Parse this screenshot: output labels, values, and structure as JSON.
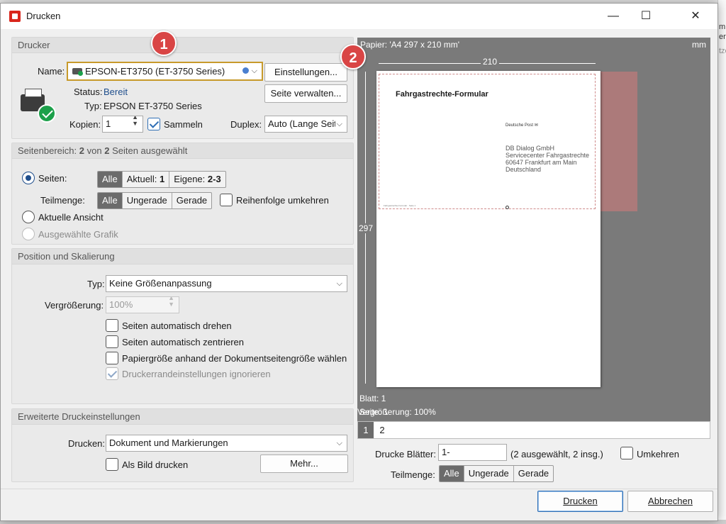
{
  "window": {
    "title": "Drucken",
    "minimize": "—",
    "maximize": "☐",
    "close": "✕"
  },
  "background": {
    "right_texts": [
      "m",
      "er",
      "tze"
    ]
  },
  "printer": {
    "section_title": "Drucker",
    "name_label": "Name:",
    "printer_name": "EPSON-ET3750 (ET-3750 Series)",
    "settings_button": "Einstellungen...",
    "manage_button": "Seite verwalten...",
    "status_label": "Status:",
    "status_value": "Bereit",
    "type_label": "Typ:",
    "type_value": "EPSON ET-3750 Series",
    "copies_label": "Kopien:",
    "copies_value": "1",
    "collate_label": "Sammeln",
    "duplex_label": "Duplex:",
    "duplex_value": "Auto (Lange Seit"
  },
  "range": {
    "section_prefix": "Seitenbereich:",
    "section_n1": "2",
    "section_mid": "von",
    "section_n2": "2",
    "section_suffix": "Seiten ausgewählt",
    "pages_label": "Seiten:",
    "pages_options": {
      "all": "Alle",
      "current_label": "Aktuell:",
      "current_value": "1",
      "custom_label": "Eigene:",
      "custom_value": "2-3"
    },
    "subset_label": "Teilmenge:",
    "subset_options": [
      "Alle",
      "Ungerade",
      "Gerade"
    ],
    "reverse_label": "Reihenfolge umkehren",
    "current_view_label": "Aktuelle Ansicht",
    "selected_graphic_label": "Ausgewählte Grafik"
  },
  "position": {
    "section_title": "Position und Skalierung",
    "type_label": "Typ:",
    "type_value": "Keine Größenanpassung",
    "zoom_label": "Vergrößerung:",
    "zoom_value": "100%",
    "options": [
      "Seiten automatisch drehen",
      "Seiten automatisch zentrieren",
      "Papiergröße anhand der Dokumentseitengröße wählen",
      "Druckerrandeinstellungen ignorieren"
    ]
  },
  "advanced": {
    "section_title": "Erweiterte Druckeinstellungen",
    "print_label": "Drucken:",
    "print_value": "Dokument und Markierungen",
    "as_image_label": "Als Bild drucken",
    "more_button": "Mehr..."
  },
  "preview": {
    "paper_label": "Papier: 'A4 297 x 210 mm'",
    "unit": "mm",
    "width_label": "210",
    "height_label": "297",
    "doc_title": "Fahrgastrechte-Formular",
    "doc_sender": "Deutsche Post ✉",
    "address_lines": [
      "DB Dialog GmbH",
      "Servicecenter Fahrgastrechte",
      "60647 Frankfurt am Main",
      "Deutschland"
    ],
    "doc_footer": "Fahrgastrechte-Formular · Seite 1",
    "sheet_label": "Blatt: 1",
    "page_label": "Seite: 1",
    "zoom_label": "Vergrößerung: 100%",
    "tabs": [
      "1",
      "2"
    ]
  },
  "sheets": {
    "label": "Drucke Blätter:",
    "value": "1-",
    "info": "(2 ausgewählt, 2 insg.)",
    "reverse_label": "Umkehren",
    "subset_label": "Teilmenge:",
    "subset_options": [
      "Alle",
      "Ungerade",
      "Gerade"
    ]
  },
  "buttons": {
    "print": "Drucken",
    "cancel": "Abbrechen"
  },
  "badges": [
    "1",
    "2"
  ],
  "colors": {
    "badge": "#d94545",
    "accent": "#2f6fb5",
    "selected_segment": "#6b6b6b",
    "status_blue": "#1f4e8c"
  }
}
